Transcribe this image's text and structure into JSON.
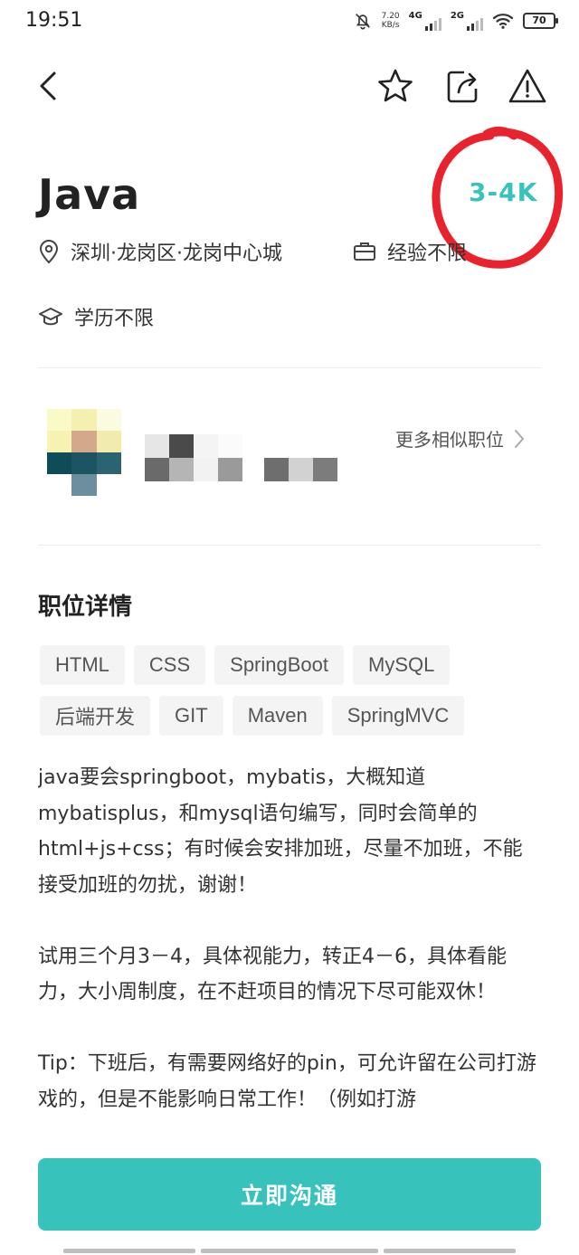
{
  "status_bar": {
    "time": "19:51",
    "net_speed_value": "7.20",
    "net_speed_unit": "KB/s",
    "signal1_label": "4G",
    "signal2_label": "2G",
    "battery": "70"
  },
  "nav": {
    "back_icon": "chevron-left-icon",
    "favorite_icon": "star-icon",
    "share_icon": "share-icon",
    "report_icon": "warning-icon"
  },
  "job": {
    "title": "Java",
    "salary": "3-4K",
    "location": "深圳·龙岗区·龙岗中心城",
    "experience": "经验不限",
    "education": "学历不限",
    "salary_color": "#37c2bc"
  },
  "recruiter": {
    "similar_jobs_label": "更多相似职位"
  },
  "details": {
    "section_title": "职位详情",
    "tags": [
      "HTML",
      "CSS",
      "SpringBoot",
      "MySQL",
      "后端开发",
      "GIT",
      "Maven",
      "SpringMVC"
    ],
    "paragraphs": [
      "java要会springboot，mybatis，大概知道mybatisplus，和mysql语句编写，同时会简单的html+js+css；有时候会安排加班，尽量不加班，不能接受加班的勿扰，谢谢！",
      "试用三个月3－4，具体视能力，转正4－6，具体看能力，大小周制度，在不赶项目的情况下尽可能双休！",
      "Tip：下班后，有需要网络好的pin，可允许留在公司打游戏的，但是不能影响日常工作！（例如打游"
    ]
  },
  "actions": {
    "chat_label": "立即沟通",
    "accent_color": "#37c2bc"
  },
  "annotation": {
    "circle_color": "#e8232e"
  }
}
